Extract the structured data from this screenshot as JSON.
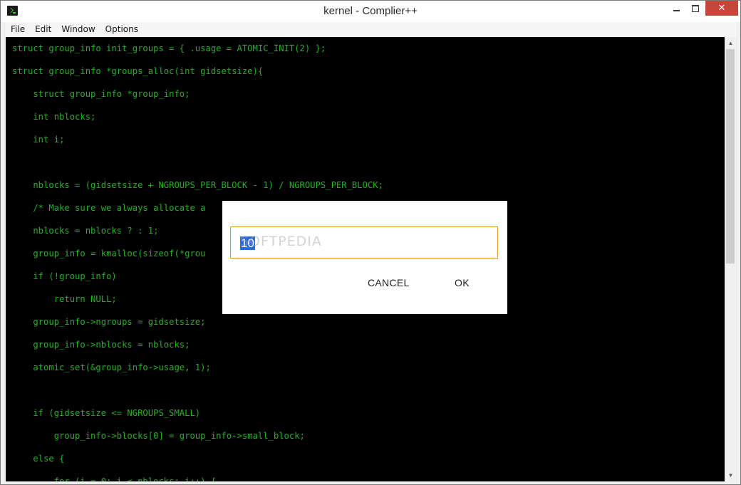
{
  "window": {
    "title": "kernel - Complier++",
    "close_glyph": "✕"
  },
  "menu": [
    "File",
    "Edit",
    "Window",
    "Options"
  ],
  "editor": {
    "text_color": "#1fb21f",
    "background": "#000000",
    "lines": [
      "struct group_info init_groups = { .usage = ATOMIC_INIT(2) };",
      "struct group_info *groups_alloc(int gidsetsize){",
      "    struct group_info *group_info;",
      "    int nblocks;",
      "    int i;",
      "",
      "    nblocks = (gidsetsize + NGROUPS_PER_BLOCK - 1) / NGROUPS_PER_BLOCK;",
      "    /* Make sure we always allocate a",
      "    nblocks = nblocks ? : 1;",
      "    group_info = kmalloc(sizeof(*grou",
      "    if (!group_info)",
      "        return NULL;",
      "    group_info->ngroups = gidsetsize;",
      "    group_info->nblocks = nblocks;",
      "    atomic_set(&group_info->usage, 1);",
      "",
      "    if (gidsetsize <= NGROUPS_SMALL)",
      "        group_info->blocks[0] = group_info->small_block;",
      "    else {",
      "        for (i = 0; i < nblocks; i++) {"
    ]
  },
  "dialog": {
    "input_value": "10",
    "watermark": "SOFTPEDIA",
    "cancel_label": "CANCEL",
    "ok_label": "OK",
    "accent": "#d4a020",
    "selection_color": "#2b6cd4"
  }
}
